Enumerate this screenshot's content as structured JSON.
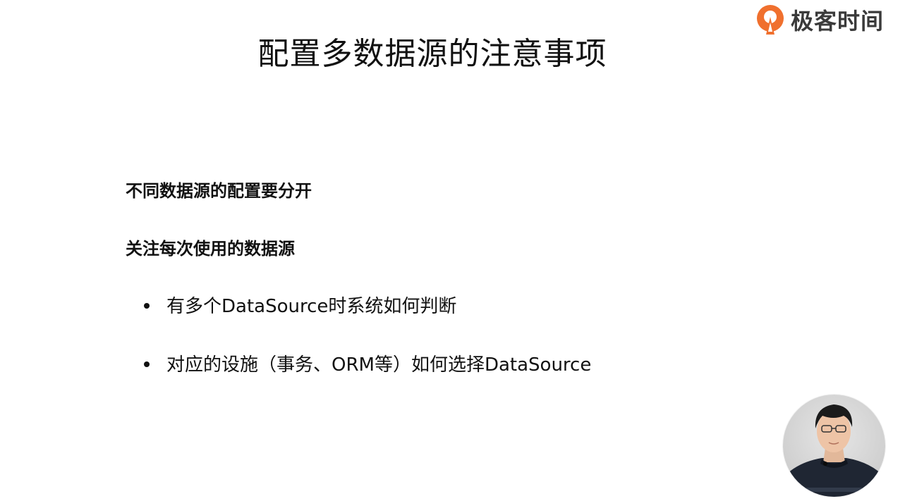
{
  "slide": {
    "title": "配置多数据源的注意事项",
    "brand": {
      "logo_icon": "geektime-logo-icon",
      "text": "极客时间",
      "accent": "#f0702e"
    },
    "sections": [
      {
        "label": "不同数据源的配置要分开"
      },
      {
        "label": "关注每次使用的数据源"
      }
    ],
    "bullets": [
      {
        "text": "有多个DataSource时系统如何判断"
      },
      {
        "text": "对应的设施（事务、ORM等）如何选择DataSource"
      }
    ],
    "presenter": {
      "icon": "presenter-video-avatar"
    }
  }
}
